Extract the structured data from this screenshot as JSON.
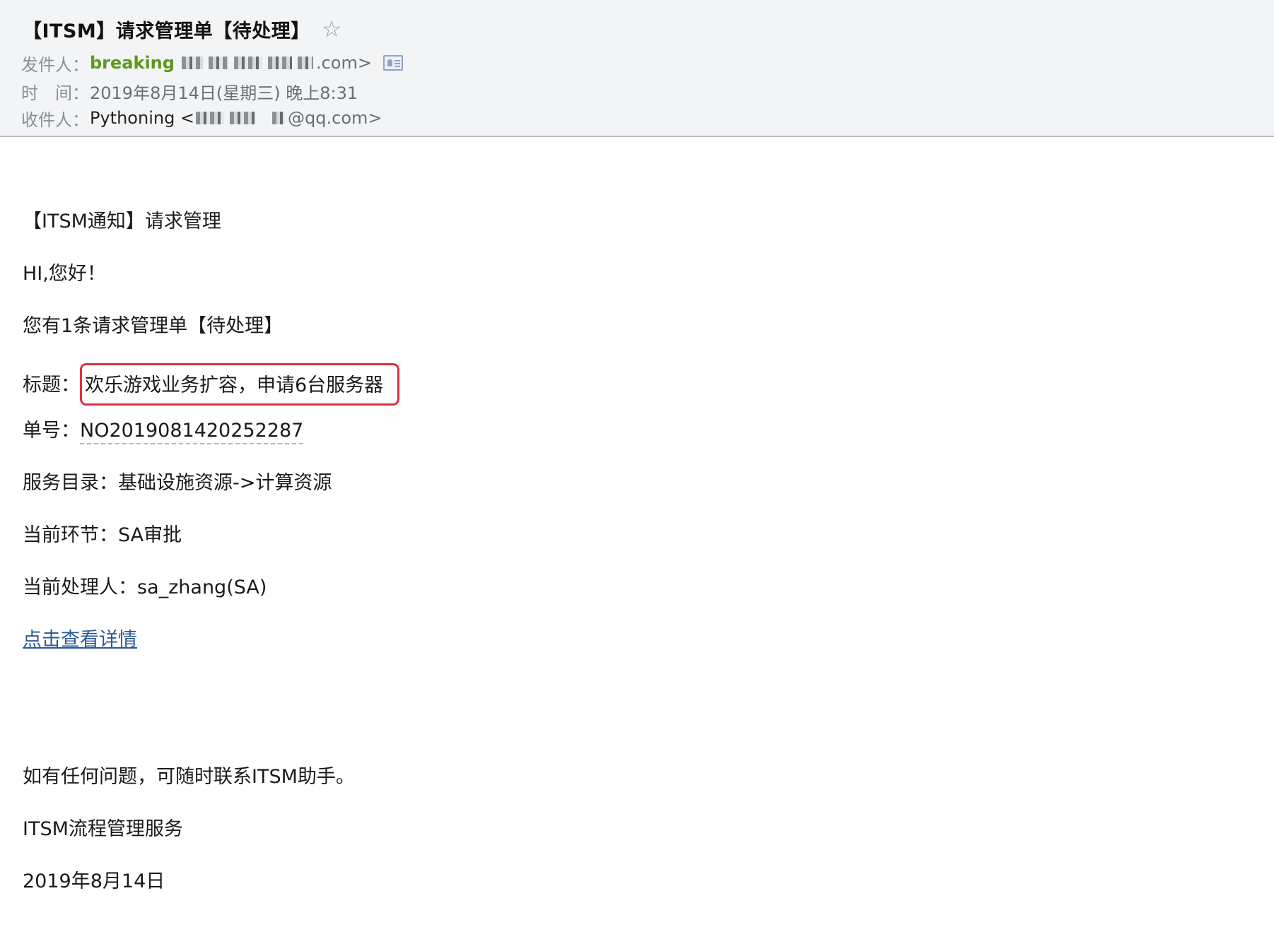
{
  "header": {
    "subject": "【ITSM】请求管理单【待处理】",
    "from_label": "发件人：",
    "from_name": "breaking",
    "from_email_suffix": ".com>",
    "time_label": "时　间：",
    "time_value": "2019年8月14日(星期三) 晚上8:31",
    "to_label": "收件人：",
    "to_name": "Pythoning <",
    "to_email_suffix": "@qq.com>"
  },
  "email": {
    "heading": "【ITSM通知】请求管理",
    "greeting": "HI,您好！",
    "pending_text": "您有1条请求管理单【待处理】",
    "title_label": "标题：",
    "title_value": "欢乐游戏业务扩容，申请6台服务器",
    "number_label": "单号：",
    "number_value": "NO2019081420252287",
    "catalog_label": "服务目录：",
    "catalog_value": "基础设施资源->计算资源",
    "stage_label": "当前环节：",
    "stage_value": "SA审批",
    "handler_label": "当前处理人：",
    "handler_value": "sa_zhang(SA)",
    "detail_link": "点击查看详情",
    "contact_text": "如有任何问题，可随时联系ITSM助手。",
    "service_name": "ITSM流程管理服务",
    "date_text": "2019年8月14日"
  },
  "colors": {
    "sender_green": "#5b9a1a",
    "highlight_red": "#e0303f",
    "link_blue": "#2a5a9a",
    "header_bg": "#f3f4f6"
  },
  "icons": {
    "star": "star-outline-icon",
    "contact": "contact-card-icon"
  }
}
